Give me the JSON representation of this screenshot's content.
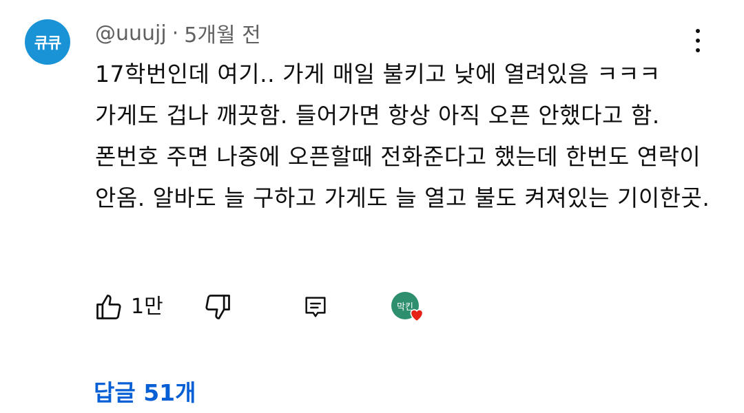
{
  "comment": {
    "avatar_text": "큐큐",
    "avatar_color": "#1a93d6",
    "author": "@uuujj",
    "separator": "·",
    "time": "5개월 전",
    "text": "17학번인데 여기.. 가게 매일 불키고 낮에 열려있음 ㅋㅋㅋ 가게도 겁나 깨끗함. 들어가면 항상 아직 오픈 안했다고 함. 폰번호 주면 나중에 오픈할때 전화준다고 했는데 한번도 연락이 안옴. 알바도 늘 구하고 가게도 늘 열고 불도 켜져있는 기이한곳.",
    "more_icon": "more-vertical-icon"
  },
  "actions": {
    "like_icon": "thumbs-up-icon",
    "like_count": "1만",
    "dislike_icon": "thumbs-down-icon",
    "reply_icon": "comment-reply-icon",
    "creator_avatar_text": "막킨",
    "creator_heart_icon": "heart-icon",
    "heart_color": "#e62117"
  },
  "replies": {
    "label": "답글 51개",
    "color": "#065fd4"
  }
}
